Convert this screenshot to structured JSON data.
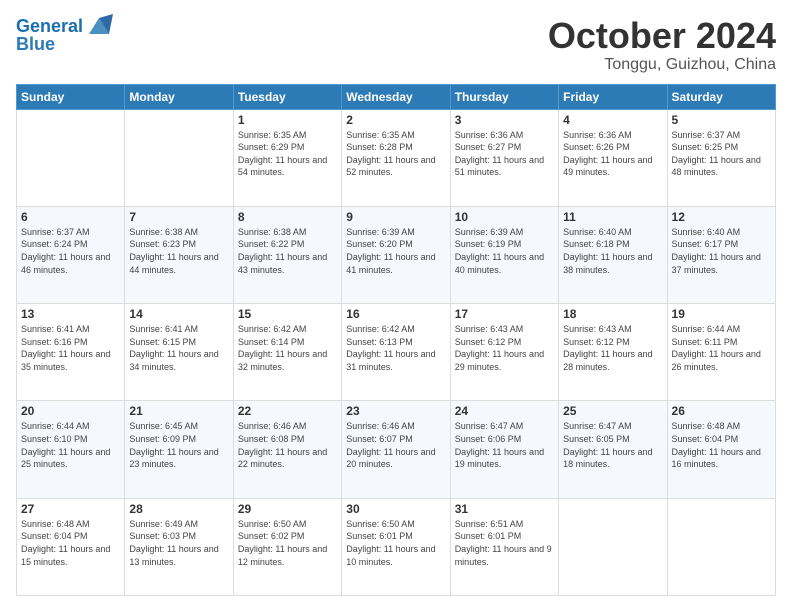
{
  "header": {
    "logo_line1": "General",
    "logo_line2": "Blue",
    "month": "October 2024",
    "location": "Tonggu, Guizhou, China"
  },
  "weekdays": [
    "Sunday",
    "Monday",
    "Tuesday",
    "Wednesday",
    "Thursday",
    "Friday",
    "Saturday"
  ],
  "weeks": [
    [
      {
        "day": "",
        "info": ""
      },
      {
        "day": "",
        "info": ""
      },
      {
        "day": "1",
        "info": "Sunrise: 6:35 AM\nSunset: 6:29 PM\nDaylight: 11 hours and 54 minutes."
      },
      {
        "day": "2",
        "info": "Sunrise: 6:35 AM\nSunset: 6:28 PM\nDaylight: 11 hours and 52 minutes."
      },
      {
        "day": "3",
        "info": "Sunrise: 6:36 AM\nSunset: 6:27 PM\nDaylight: 11 hours and 51 minutes."
      },
      {
        "day": "4",
        "info": "Sunrise: 6:36 AM\nSunset: 6:26 PM\nDaylight: 11 hours and 49 minutes."
      },
      {
        "day": "5",
        "info": "Sunrise: 6:37 AM\nSunset: 6:25 PM\nDaylight: 11 hours and 48 minutes."
      }
    ],
    [
      {
        "day": "6",
        "info": "Sunrise: 6:37 AM\nSunset: 6:24 PM\nDaylight: 11 hours and 46 minutes."
      },
      {
        "day": "7",
        "info": "Sunrise: 6:38 AM\nSunset: 6:23 PM\nDaylight: 11 hours and 44 minutes."
      },
      {
        "day": "8",
        "info": "Sunrise: 6:38 AM\nSunset: 6:22 PM\nDaylight: 11 hours and 43 minutes."
      },
      {
        "day": "9",
        "info": "Sunrise: 6:39 AM\nSunset: 6:20 PM\nDaylight: 11 hours and 41 minutes."
      },
      {
        "day": "10",
        "info": "Sunrise: 6:39 AM\nSunset: 6:19 PM\nDaylight: 11 hours and 40 minutes."
      },
      {
        "day": "11",
        "info": "Sunrise: 6:40 AM\nSunset: 6:18 PM\nDaylight: 11 hours and 38 minutes."
      },
      {
        "day": "12",
        "info": "Sunrise: 6:40 AM\nSunset: 6:17 PM\nDaylight: 11 hours and 37 minutes."
      }
    ],
    [
      {
        "day": "13",
        "info": "Sunrise: 6:41 AM\nSunset: 6:16 PM\nDaylight: 11 hours and 35 minutes."
      },
      {
        "day": "14",
        "info": "Sunrise: 6:41 AM\nSunset: 6:15 PM\nDaylight: 11 hours and 34 minutes."
      },
      {
        "day": "15",
        "info": "Sunrise: 6:42 AM\nSunset: 6:14 PM\nDaylight: 11 hours and 32 minutes."
      },
      {
        "day": "16",
        "info": "Sunrise: 6:42 AM\nSunset: 6:13 PM\nDaylight: 11 hours and 31 minutes."
      },
      {
        "day": "17",
        "info": "Sunrise: 6:43 AM\nSunset: 6:12 PM\nDaylight: 11 hours and 29 minutes."
      },
      {
        "day": "18",
        "info": "Sunrise: 6:43 AM\nSunset: 6:12 PM\nDaylight: 11 hours and 28 minutes."
      },
      {
        "day": "19",
        "info": "Sunrise: 6:44 AM\nSunset: 6:11 PM\nDaylight: 11 hours and 26 minutes."
      }
    ],
    [
      {
        "day": "20",
        "info": "Sunrise: 6:44 AM\nSunset: 6:10 PM\nDaylight: 11 hours and 25 minutes."
      },
      {
        "day": "21",
        "info": "Sunrise: 6:45 AM\nSunset: 6:09 PM\nDaylight: 11 hours and 23 minutes."
      },
      {
        "day": "22",
        "info": "Sunrise: 6:46 AM\nSunset: 6:08 PM\nDaylight: 11 hours and 22 minutes."
      },
      {
        "day": "23",
        "info": "Sunrise: 6:46 AM\nSunset: 6:07 PM\nDaylight: 11 hours and 20 minutes."
      },
      {
        "day": "24",
        "info": "Sunrise: 6:47 AM\nSunset: 6:06 PM\nDaylight: 11 hours and 19 minutes."
      },
      {
        "day": "25",
        "info": "Sunrise: 6:47 AM\nSunset: 6:05 PM\nDaylight: 11 hours and 18 minutes."
      },
      {
        "day": "26",
        "info": "Sunrise: 6:48 AM\nSunset: 6:04 PM\nDaylight: 11 hours and 16 minutes."
      }
    ],
    [
      {
        "day": "27",
        "info": "Sunrise: 6:48 AM\nSunset: 6:04 PM\nDaylight: 11 hours and 15 minutes."
      },
      {
        "day": "28",
        "info": "Sunrise: 6:49 AM\nSunset: 6:03 PM\nDaylight: 11 hours and 13 minutes."
      },
      {
        "day": "29",
        "info": "Sunrise: 6:50 AM\nSunset: 6:02 PM\nDaylight: 11 hours and 12 minutes."
      },
      {
        "day": "30",
        "info": "Sunrise: 6:50 AM\nSunset: 6:01 PM\nDaylight: 11 hours and 10 minutes."
      },
      {
        "day": "31",
        "info": "Sunrise: 6:51 AM\nSunset: 6:01 PM\nDaylight: 11 hours and 9 minutes."
      },
      {
        "day": "",
        "info": ""
      },
      {
        "day": "",
        "info": ""
      }
    ]
  ]
}
